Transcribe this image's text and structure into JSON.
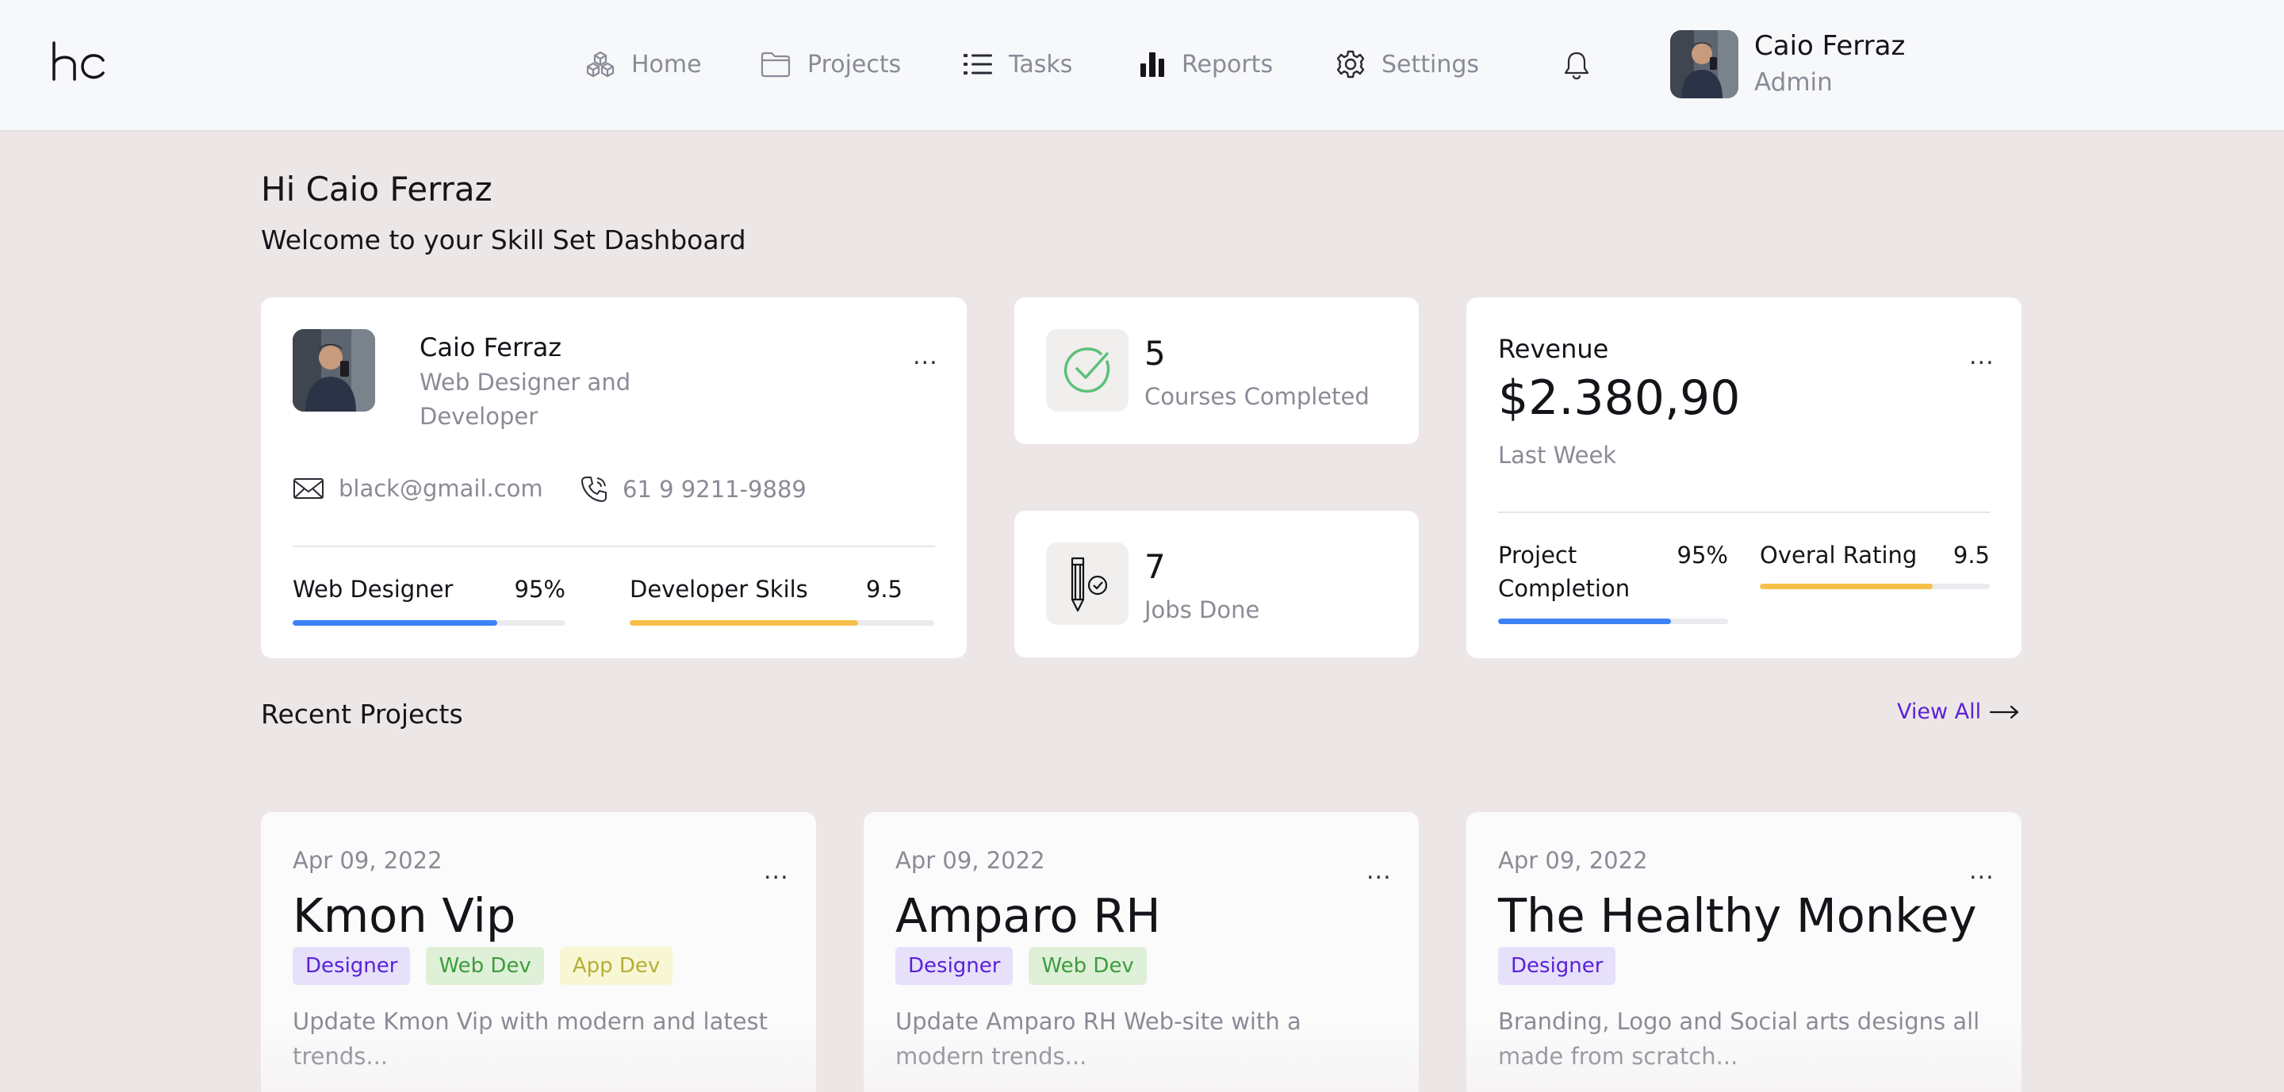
{
  "nav": {
    "logo_text": "hc",
    "items": [
      {
        "label": "Home",
        "icon": "cubes-icon"
      },
      {
        "label": "Projects",
        "icon": "folder-icon"
      },
      {
        "label": "Tasks",
        "icon": "list-icon"
      },
      {
        "label": "Reports",
        "icon": "bar-chart-icon"
      },
      {
        "label": "Settings",
        "icon": "gear-icon"
      }
    ],
    "notifications_icon": "bell-icon"
  },
  "user": {
    "name": "Caio Ferraz",
    "role": "Admin"
  },
  "greeting": {
    "title": "Hi Caio Ferraz",
    "subtitle": "Welcome to your Skill Set Dashboard"
  },
  "profile_card": {
    "name": "Caio Ferraz",
    "title": "Web Designer and Developer",
    "email": "black@gmail.com",
    "phone": "61 9 9211-9889",
    "menu": "...",
    "skills": [
      {
        "label": "Web Designer",
        "value": "95%",
        "progress": 0.75,
        "color": "#3b82f6"
      },
      {
        "label": "Developer Skils",
        "value": "9.5",
        "progress": 0.75,
        "color": "#f5c04a"
      }
    ]
  },
  "stats": [
    {
      "value": "5",
      "label": "Courses Completed",
      "icon": "check-circle-icon"
    },
    {
      "value": "7",
      "label": "Jobs Done",
      "icon": "pencil-check-icon"
    }
  ],
  "revenue_card": {
    "label": "Revenue",
    "amount": "$2.380,90",
    "period": "Last Week",
    "menu": "...",
    "metrics": [
      {
        "label": "Project Completion",
        "value": "95%",
        "progress": 0.75,
        "color": "#3b82f6"
      },
      {
        "label": "Overal Rating",
        "value": "9.5",
        "progress": 0.75,
        "color": "#f5c04a"
      }
    ]
  },
  "recent_projects": {
    "title": "Recent Projects",
    "view_all": "View All",
    "items": [
      {
        "date": "Apr 09, 2022",
        "name": "Kmon Vip",
        "tags": [
          "Designer",
          "Web Dev",
          "App Dev"
        ],
        "description": "Update Kmon Vip with modern and latest trends...",
        "menu": "..."
      },
      {
        "date": "Apr 09, 2022",
        "name": "Amparo RH",
        "tags": [
          "Designer",
          "Web Dev"
        ],
        "description": "Update Amparo RH Web-site with a modern trends...",
        "menu": "..."
      },
      {
        "date": "Apr 09, 2022",
        "name": "The Healthy Monkey",
        "tags": [
          "Designer"
        ],
        "description": "Branding, Logo and Social arts designs all made from scratch...",
        "menu": "..."
      }
    ]
  },
  "colors": {
    "background": "#ede6e6",
    "accent_purple": "#5b21d6",
    "progress_blue": "#3b82f6",
    "progress_yellow": "#f5c04a",
    "check_green": "#5cc07a"
  }
}
